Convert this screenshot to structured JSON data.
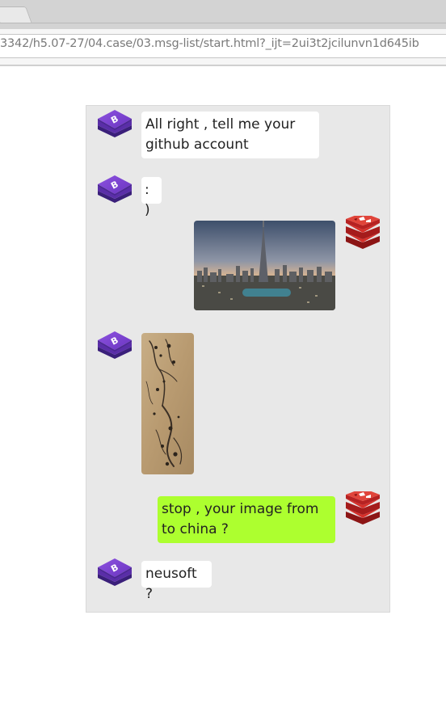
{
  "browser": {
    "url": "3342/h5.07-27/04.case/03.msg-list/start.html?_ijt=2ui3t2jcilunvn1d645ib"
  },
  "chat": {
    "messages": [
      {
        "side": "left",
        "avatar": "bootstrap-logo-icon",
        "type": "text",
        "text": "All right , tell me your github account"
      },
      {
        "side": "left",
        "avatar": "bootstrap-logo-icon",
        "type": "text",
        "text": ": )"
      },
      {
        "side": "right",
        "avatar": "redis-logo-icon",
        "type": "image",
        "image": "city-skyline-photo"
      },
      {
        "side": "left",
        "avatar": "bootstrap-logo-icon",
        "type": "image",
        "image": "ink-painting-photo"
      },
      {
        "side": "right",
        "avatar": "redis-logo-icon",
        "type": "text",
        "text": "stop , your image from to china ?",
        "bubble_color": "#adff2f"
      },
      {
        "side": "left",
        "avatar": "bootstrap-logo-icon",
        "type": "text",
        "text": "neusoft ?"
      }
    ]
  },
  "colors": {
    "chat_background": "#e8e8e8",
    "bubble_default": "#ffffff",
    "bubble_green": "#adff2f",
    "bootstrap_purple": "#6f3ec3",
    "redis_red": "#c8282a"
  }
}
